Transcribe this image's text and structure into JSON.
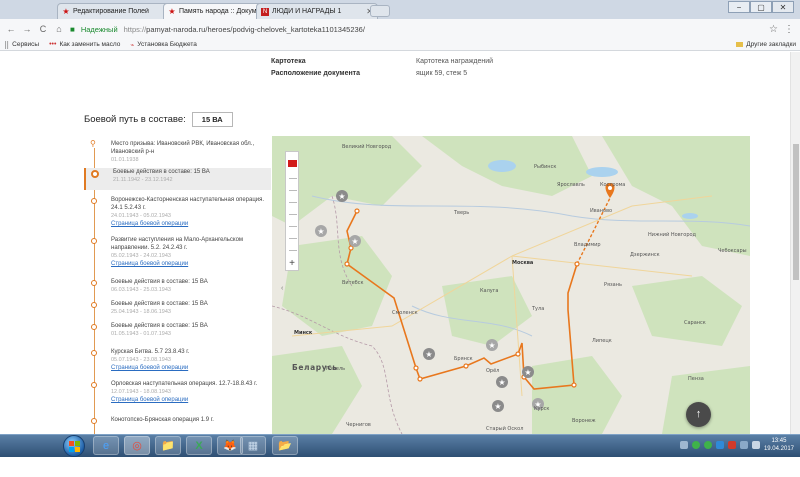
{
  "browser": {
    "tabs": [
      {
        "title": "Редактирование Полей",
        "fav": "★"
      },
      {
        "title": "Память народа :: Докум",
        "fav": "★"
      },
      {
        "title": "ЛЮДИ И НАГРАДЫ 1",
        "fav": "N"
      }
    ],
    "window_buttons": [
      "−",
      "▢",
      "✕"
    ],
    "nav": {
      "back": "←",
      "forward": "→",
      "reload": "C",
      "home": "⌂"
    },
    "secure_label": "Надежный",
    "url_scheme": "https://",
    "url_rest": "pamyat-naroda.ru/heroes/podvig-chelovek_kartoteka1101345236/",
    "star": "☆",
    "menu": "⋮"
  },
  "bookmarks": {
    "apps": "Сервисы",
    "items": [
      "Как заменить масло",
      "Установка Бюджета"
    ],
    "other": "Другие закладки"
  },
  "doc_info": [
    {
      "key": "Картотека",
      "value": "Картотека награждений"
    },
    {
      "key": "Расположение документа",
      "value": "ящик 59, стеж 5"
    }
  ],
  "combat_path": {
    "label": "Боевой путь в составе:",
    "unit": "15 ВА"
  },
  "timeline": [
    {
      "title": "Место призыва: Ивановский РВК, Ивановская обл., Ивановский р-н",
      "date": "01.01.1938",
      "link": "",
      "marker": "pin"
    },
    {
      "title": "Боевые действия в составе: 15 ВА",
      "date": "21.11.1942 - 23.12.1942",
      "link": "",
      "marker": "current",
      "selected": true
    },
    {
      "title": "Воронежско-Касторненская наступательная операция. 24.1 5.2.43 г.",
      "date": "24.01.1943 - 05.02.1943",
      "link": "Страница боевой операции",
      "marker": "dot"
    },
    {
      "title": "Развитие наступления на Мало-Архангельском направлении. 5.2. 24.2.43 г.",
      "date": "05.02.1943 - 24.02.1943",
      "link": "Страница боевой операции",
      "marker": "dot"
    },
    {
      "title": "Боевые действия в составе: 15 ВА",
      "date": "06.03.1943 - 25.03.1943",
      "link": "",
      "marker": "dot"
    },
    {
      "title": "Боевые действия в составе: 15 ВА",
      "date": "25.04.1943 - 18.06.1943",
      "link": "",
      "marker": "dot"
    },
    {
      "title": "Боевые действия в составе: 15 ВА",
      "date": "01.05.1943 - 01.07.1943",
      "link": "",
      "marker": "dot"
    },
    {
      "title": "Курская Битва. 5.7 23.8.43 г.",
      "date": "05.07.1943 - 23.08.1943",
      "link": "Страница боевой операции",
      "marker": "dot"
    },
    {
      "title": "Орловская наступательная операция. 12.7-18.8.43 г.",
      "date": "12.07.1943 - 18.08.1943",
      "link": "Страница боевой операции",
      "marker": "dot"
    },
    {
      "title": "Конотопско-Брянская операция 1.9 г.",
      "date": "",
      "link": "",
      "marker": "dot"
    }
  ],
  "map": {
    "labels": [
      {
        "text": "Великий Новгород",
        "cls": "city"
      },
      {
        "text": "Рыбинск",
        "cls": "city"
      },
      {
        "text": "Ярославль",
        "cls": "city"
      },
      {
        "text": "Кострома",
        "cls": "city"
      },
      {
        "text": "Иваново",
        "cls": "city"
      },
      {
        "text": "Тверь",
        "cls": "city"
      },
      {
        "text": "Нижний Новгород",
        "cls": "city"
      },
      {
        "text": "Владимир",
        "cls": "city"
      },
      {
        "text": "Дзержинск",
        "cls": "city"
      },
      {
        "text": "Чебоксары",
        "cls": "city"
      },
      {
        "text": "Москва",
        "cls": "capital"
      },
      {
        "text": "Витебск",
        "cls": "city"
      },
      {
        "text": "Смоленск",
        "cls": "city"
      },
      {
        "text": "Минск",
        "cls": "capital"
      },
      {
        "text": "Беларусь",
        "cls": "country"
      },
      {
        "text": "Гомель",
        "cls": "city"
      },
      {
        "text": "Брянск",
        "cls": "city"
      },
      {
        "text": "Орёл",
        "cls": "city"
      },
      {
        "text": "Курск",
        "cls": "city"
      },
      {
        "text": "Липецк",
        "cls": "city"
      },
      {
        "text": "Воронеж",
        "cls": "city"
      },
      {
        "text": "Рязань",
        "cls": "city"
      },
      {
        "text": "Тула",
        "cls": "city"
      },
      {
        "text": "Саранск",
        "cls": "city"
      },
      {
        "text": "Пенза",
        "cls": "city"
      },
      {
        "text": "Чернигов",
        "cls": "city"
      },
      {
        "text": "Старый Оскол",
        "cls": "city"
      },
      {
        "text": "Калуга",
        "cls": "city"
      }
    ],
    "zoom_plus": "+",
    "zoom_minus": "−",
    "collapse": "‹",
    "up": "↑"
  },
  "taskbar": {
    "apps": [
      "e",
      "◎",
      "📁",
      "X",
      "🦊",
      "▦",
      "📂"
    ],
    "time": "13:45",
    "date": "19.04.2017"
  }
}
